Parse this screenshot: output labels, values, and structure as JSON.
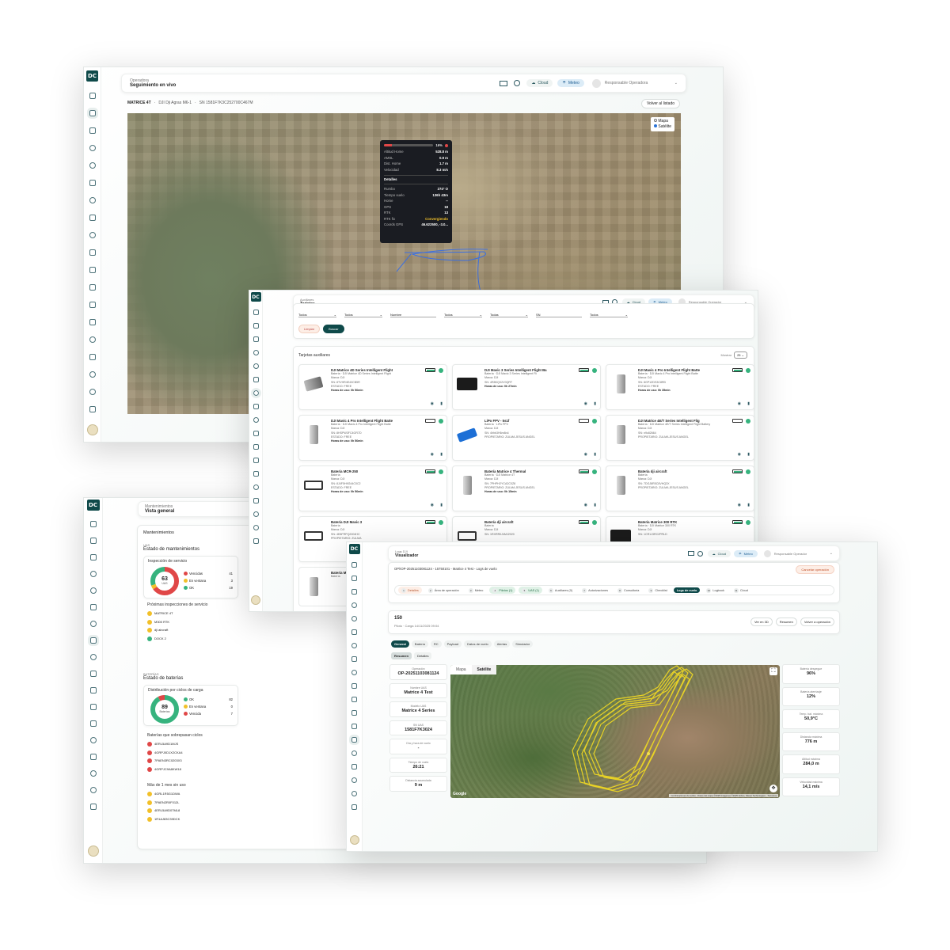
{
  "colors": {
    "brand": "#0f4a4a",
    "green": "#36b37e",
    "red": "#e04747",
    "yellow": "#f2c029",
    "track": "#e8d226"
  },
  "icons": {
    "logo": "DC",
    "sidebar": [
      "map-icon",
      "grid-icon",
      "calendar-icon",
      "stack-icon",
      "drone-icon",
      "hand-icon",
      "target-icon",
      "wrench-icon",
      "route-icon",
      "clipboard-icon",
      "chart-icon",
      "book-icon",
      "battery-icon",
      "link-icon",
      "cap-icon",
      "share-icon",
      "bell-icon",
      "file-icon"
    ]
  },
  "w1": {
    "header": {
      "section": "Operadora",
      "title": "Seguimiento en vivo",
      "cloud": "Cloud",
      "meteo": "Meteo",
      "user": "Responsable Operadora"
    },
    "drone": {
      "model": "MATRICE 4T",
      "sep1": "·",
      "op": "DJI Dji Agras M6-1",
      "sep2": "·",
      "sn": "SN 1581F7K3C252700C467M"
    },
    "back_button": "Volver al listado",
    "map_layers": [
      "Mapa",
      "Satélite"
    ],
    "telemetry": {
      "battery": "16%",
      "rows": [
        [
          "Altitud Home",
          "528.8 m"
        ],
        [
          "AMSL",
          "0.9 m"
        ],
        [
          "Dist. Home",
          "1.7 m"
        ],
        [
          "Velocidad",
          "8.3 m/s"
        ]
      ],
      "details_title": "Detalles",
      "rows2": [
        [
          "Rumbo",
          "274° O"
        ],
        [
          "Tiempo vuelo",
          "136h 43m"
        ],
        [
          "Home",
          "--"
        ],
        [
          "GPS",
          "18"
        ],
        [
          "RTK",
          "13"
        ],
        [
          "RTK fix",
          "Convergiendo"
        ],
        [
          "Coords GPS",
          "46.622500, -3.0..."
        ]
      ]
    }
  },
  "w2": {
    "header": {
      "section": "Auxiliares",
      "title": "Tarjetas",
      "cloud": "Cloud",
      "meteo": "Meteo",
      "user": "Responsable Operador"
    },
    "filters_title": "Filtros Auxiliares",
    "top_buttons": [
      "Todos",
      "Baterías",
      "Nuevo"
    ],
    "filters": [
      "Todos",
      "Todos",
      "Nombre",
      "Todos",
      "Todas",
      "SN",
      "Todos"
    ],
    "clear": "Limpiar",
    "search": "Buscar",
    "list_title": "Tarjetas auxiliares",
    "show_label": "Mostrar",
    "show_value": "25",
    "cards": [
      {
        "title": "DJI Matrice 4D Series Intelligent Flight",
        "sub": "Batería · DJI Matrice 4D Series Intelligent Flight",
        "brand": "Marca: DJI",
        "sn": "SN: 8TVHR4E43CB5R",
        "state": "ESTADO: FREE",
        "usage": "Horas de uso: 0h 56min",
        "pct": "100",
        "img": "dark"
      },
      {
        "title": "DJI Mavic 3 Series Intelligent Flight Ba",
        "sub": "Batería · DJI Mavic 3 Series Intelligent Fli",
        "brand": "Marca: DJI",
        "sn": "SN: 4R8KQX2V0QRT",
        "state": "",
        "usage": "Horas de uso: 0h 27min",
        "pct": "100",
        "img": "black"
      },
      {
        "title": "DJI Mavic 4 Pro Intelligent Flight Batte",
        "sub": "Batería · DJI Mavic 4 Pro Intelligent Flight Batte",
        "brand": "Marca: DJI",
        "sn": "SN: 8GP1ZDS3C8RD",
        "state": "ESTADO: FREE",
        "usage": "Horas de uso: 0h 35min",
        "pct": "100",
        "img": "grey"
      },
      {
        "title": "DJI Mavic 4 Pro Intelligent Flight Batte",
        "sub": "Batería · DJI Mavic 4 Pro Intelligent Flight Batte",
        "brand": "Marca: DJI",
        "sn": "SN: 8HSPW3FC4GR7D",
        "state": "ESTADO: FREE",
        "usage": "Horas de uso: 0h 56min",
        "pct": "0",
        "img": "grey"
      },
      {
        "title": "LiPo FPV - 5s1f",
        "sub": "Batería · LiPo FPV",
        "brand": "Marca: DJI",
        "sn": "SN: 4hhb3H6m8n4",
        "state": "PROPIETARIO: ZULMA JESUS ANGEL",
        "usage": "",
        "pct": "0",
        "img": "blue"
      },
      {
        "title": "DJI Matrice 4E/T Series Intelligent Flig",
        "sub": "Batería · DJI Matrice 4E/T Series Intelligent Flight Battery",
        "brand": "Marca: DJI",
        "sn": "SN: n9c82664",
        "state": "PROPIETARIO: ZULMA JESUS ANGEL",
        "usage": "",
        "pct": "0",
        "img": "grey"
      },
      {
        "title": "Batería MCR-250",
        "sub": "Batería",
        "brand": "Marca: DJI",
        "sn": "SN: 8J4F5H9G44C0C2",
        "state": "ESTADO: FREE",
        "usage": "Horas de uso: 0h 56min",
        "pct": "100",
        "img": "outline"
      },
      {
        "title": "Batería Matrice 4 Thermal",
        "sub": "Batería · DJI Matrice 4T",
        "brand": "Marca: DJI",
        "sn": "SN: 7PHPH2YCA2C0Z8",
        "state": "PROPIETARIO: ZULMA JESUS ANGEL",
        "usage": "Horas de uso: 0h 15min",
        "pct": "100",
        "img": "grey"
      },
      {
        "title": "Batería dji aircraft",
        "sub": "Batería",
        "brand": "Marca: DJI",
        "sn": "SN: 7DGJ8R5C8VHQ3X",
        "state": "PROPIETARIO: ZULMA JESUS ANGEL",
        "usage": "",
        "pct": "100",
        "img": "grey"
      },
      {
        "title": "Batería DJI Mavic 3",
        "sub": "Batería",
        "brand": "Marca: DJI",
        "sn": "SN: 4E8FRPQ2004HC",
        "state": "PROPIETARIO: ZULMA",
        "usage": "",
        "pct": "100",
        "img": "outline"
      },
      {
        "title": "Batería dji aircraft",
        "sub": "Batería",
        "brand": "Marca: DJI",
        "sn": "SN: 1RXRR0J4MJ2020",
        "state": "",
        "usage": "",
        "pct": "100",
        "img": "outline"
      },
      {
        "title": "Batería Matrice 300 RTK",
        "sub": "Batería · DJI Matrice 300 RTK",
        "brand": "Marca: DJI",
        "sn": "SN: 1CR1J3RC2PRLD",
        "state": "",
        "usage": "",
        "pct": "100",
        "img": "black"
      }
    ],
    "partial": [
      {
        "title": "Batería M",
        "sub": "Batería"
      },
      {
        "title": "Batería D",
        "sub": "Batería"
      }
    ]
  },
  "w3": {
    "header": {
      "section": "Mantenimientos",
      "title": "Vista general"
    },
    "block_title": "Mantenimientos",
    "sec1": {
      "kicker": "UAS",
      "title": "Estado de mantenimientos",
      "donut_title": "Inspección de servicio",
      "center": "63",
      "center_label": "UAS",
      "legend": [
        [
          "Vencidas",
          "41",
          "red"
        ],
        [
          "En ventana",
          "3",
          "yellow"
        ],
        [
          "OK",
          "19",
          "green"
        ]
      ],
      "list_title": "Próximas inspecciones de servicio",
      "list": [
        [
          "MATRICE 4T",
          "yellow"
        ],
        [
          "M300 RTK",
          "yellow"
        ],
        [
          "dji aircraft",
          "yellow"
        ],
        [
          "DOCK 2",
          "green"
        ]
      ]
    },
    "sec2": {
      "kicker": "BATERÍAS",
      "title": "Estado de baterías",
      "donut_title": "Distribución por ciclos de carga",
      "center": "89",
      "center_label": "Baterías",
      "legend": [
        [
          "OK",
          "82",
          "green"
        ],
        [
          "En ventana",
          "0",
          "yellow"
        ],
        [
          "Vencida",
          "7",
          "red"
        ]
      ],
      "list_title": "Baterías que sobrepasan ciclos",
      "list": [
        "4ERL5A9D1MJS",
        "4GRPJ0D1X2CKA4",
        "7PAEN3RC0203X3",
        "4GRPJC9A8KW18"
      ],
      "list2_title": "Más de 1 mes sin uso",
      "list2": [
        "4GRL1R5G1DWA",
        "7PAEN2R0F012L",
        "4ERL5A9D07ML8",
        "1R1AJ83C39DCK"
      ]
    }
  },
  "w4": {
    "header": {
      "section": "Logs DJI",
      "title": "Visualizador",
      "cloud": "Cloud",
      "meteo": "Meteo",
      "user": "Responsable Operador"
    },
    "breadcrumb": "OP/IOP-20251103081124 - 15750101 - Matrice 4 Test - Logs de vuelo",
    "cancel": "Cancelar operación",
    "steps": [
      [
        "1",
        "Detalles",
        "ok"
      ],
      [
        "2",
        "Área de operación",
        ""
      ],
      [
        "3",
        "Meteo",
        ""
      ],
      [
        "4",
        "Pilotos (1)",
        "ok"
      ],
      [
        "5",
        "UAS (1)",
        "ok"
      ],
      [
        "6",
        "Auxiliares (0)",
        ""
      ],
      [
        "7",
        "Autorizaciones",
        ""
      ],
      [
        "8",
        "Consultoría",
        ""
      ],
      [
        "9",
        "Checklist",
        ""
      ],
      [
        "",
        "Logs de vuelo",
        "active"
      ],
      [
        "10",
        "Logbook",
        ""
      ],
      [
        "11",
        "Cloud",
        ""
      ]
    ],
    "flight_num": "150",
    "flight_sub": "Piloto · Carga 14/11/2025 09:04",
    "actions": [
      "Ver en 3D",
      "Resumen",
      "Volver a operación"
    ],
    "tabs": [
      "General",
      "Batería",
      "RC",
      "Payload",
      "Datos de vuelo",
      "Alertas",
      "Simulador"
    ],
    "subtabs": [
      "Resumen",
      "Detalles"
    ],
    "left_stats": [
      [
        "Operación",
        "OP-20251103081124"
      ],
      [
        "Nombre UAS",
        "Matrice 4 Test"
      ],
      [
        "Modelo UAS",
        "Matrice 4 Series"
      ],
      [
        "SN UAS",
        "1581F7K3024"
      ],
      [
        "Día y hora de vuelo",
        "-"
      ],
      [
        "Tiempo de vuelo",
        "26:21"
      ],
      [
        "Distancia acumulada",
        "9 m"
      ]
    ],
    "right_stats": [
      [
        "Batería despegue",
        "96%"
      ],
      [
        "Batería aterrizaje",
        "12%"
      ],
      [
        "Temp. bat. máxima",
        "50,9°C"
      ],
      [
        "Distancia máxima",
        "776 m"
      ],
      [
        "Altitud máxima",
        "284,0 m"
      ],
      [
        "Velocidad máxima",
        "14,1 m/s"
      ]
    ],
    "map_tabs": [
      "Mapa",
      "Satélite"
    ],
    "google": "Google",
    "attribution": "Combinaciones de teclas · Datos del mapa ©2025 Imágenes ©2025 Airbus, Maxar Technologies · Términos"
  }
}
